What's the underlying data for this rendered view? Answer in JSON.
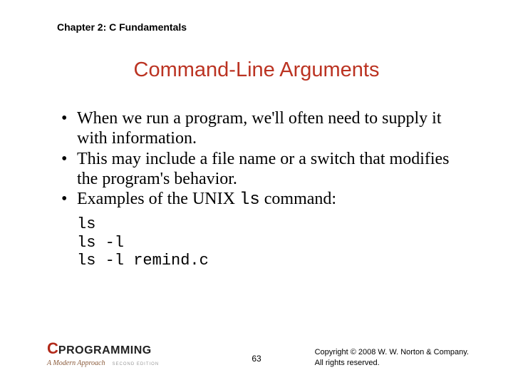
{
  "chapter": "Chapter 2: C Fundamentals",
  "title": "Command-Line Arguments",
  "bullets": [
    {
      "text": "When we run a program, we'll often need to supply it with information."
    },
    {
      "text": "This may include a file name or a switch that modifies the program's behavior."
    },
    {
      "prefix": "Examples of the UNIX ",
      "mono": "ls",
      "suffix": " command:"
    }
  ],
  "code": "ls\nls -l\nls -l remind.c",
  "logo": {
    "c": "C",
    "prog": "PROGRAMMING",
    "sub": "A Modern Approach",
    "ed": "SECOND EDITION"
  },
  "page": "63",
  "copyright_line1": "Copyright © 2008 W. W. Norton & Company.",
  "copyright_line2": "All rights reserved."
}
